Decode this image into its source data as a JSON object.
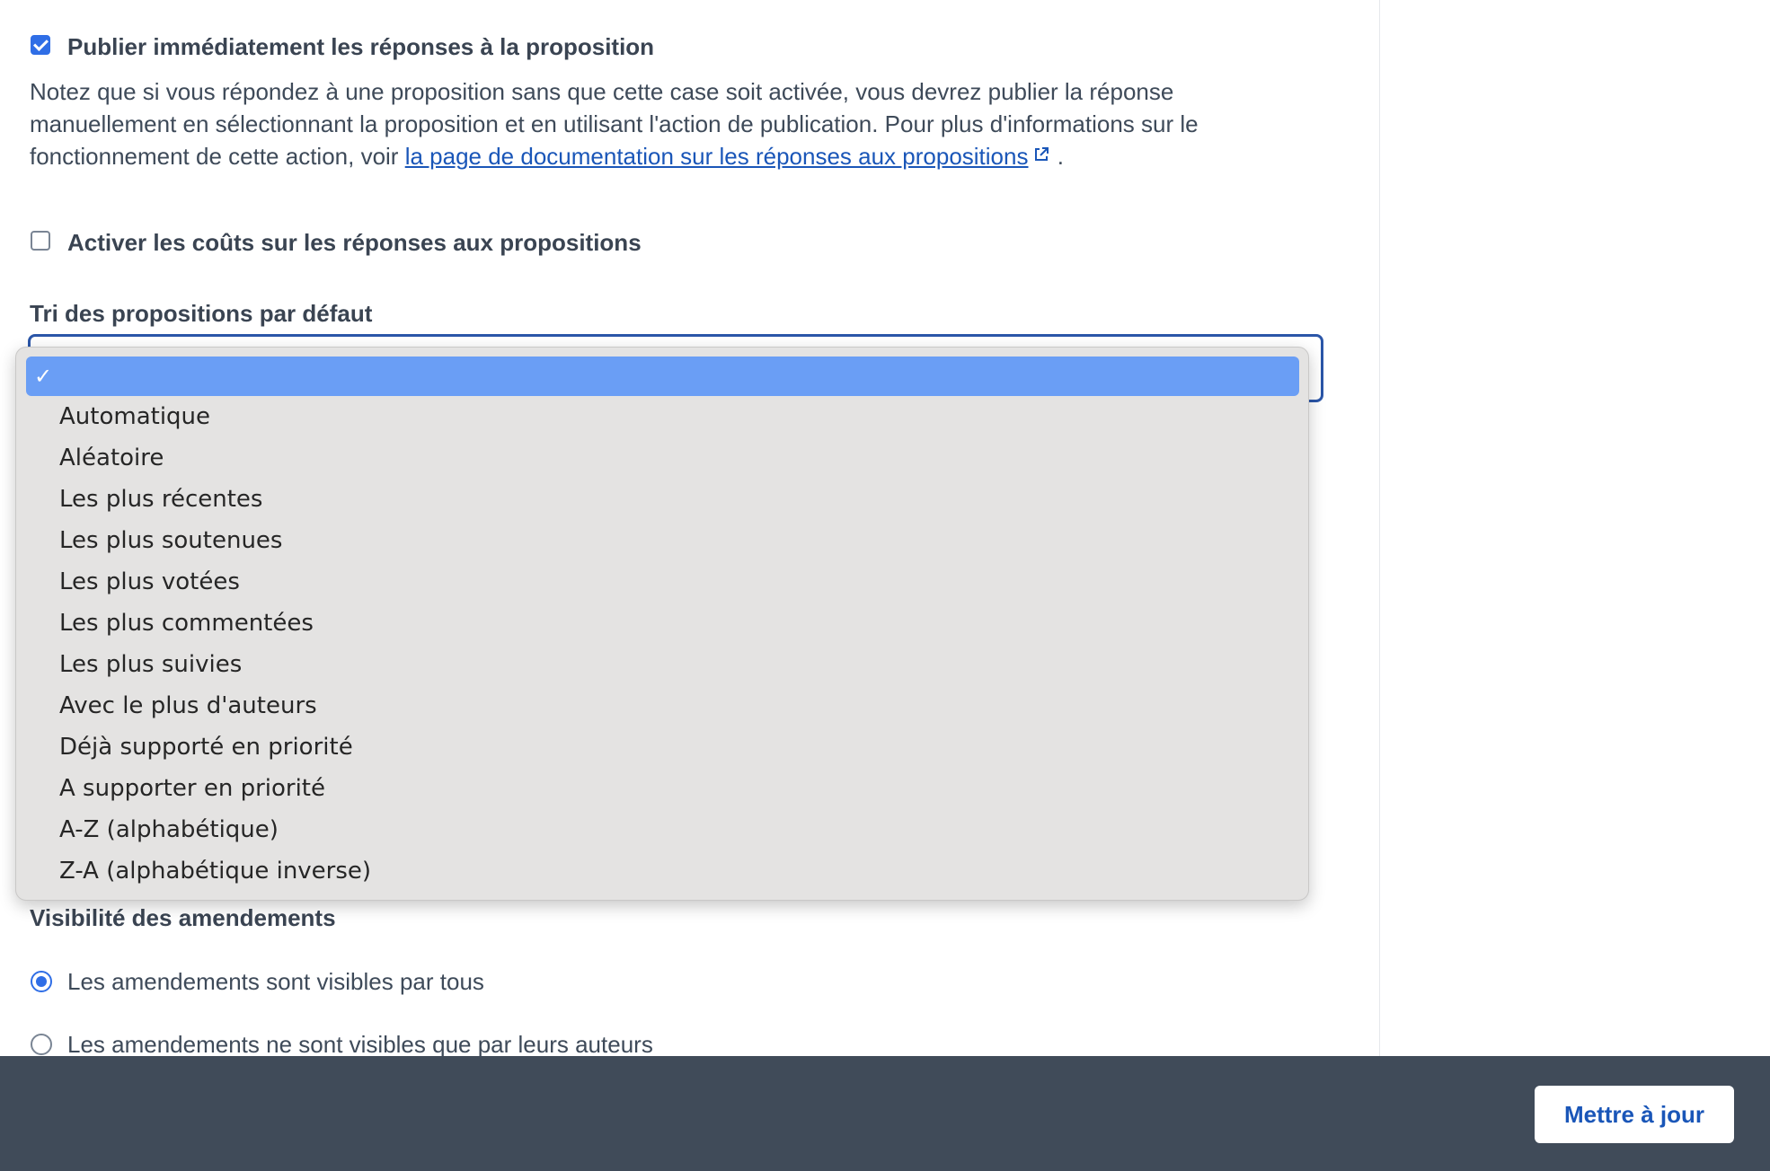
{
  "settings": {
    "publish_responses": {
      "label": "Publier immédiatement les réponses à la proposition",
      "checked": true,
      "help_prefix": "Notez que si vous répondez à une proposition sans que cette case soit activée, vous devrez publier la réponse manuellement en sélectionnant la proposition et en utilisant l'action de publication. Pour plus d'informations sur le fonctionnement de cette action, voir ",
      "help_link": "la page de documentation sur les réponses aux propositions",
      "help_suffix": " ."
    },
    "enable_costs": {
      "label": "Activer les coûts sur les réponses aux propositions",
      "checked": false
    },
    "default_sort": {
      "label": "Tri des propositions par défaut",
      "selected_value": "",
      "options": [
        "",
        "Automatique",
        "Aléatoire",
        "Les plus récentes",
        "Les plus soutenues",
        "Les plus votées",
        "Les plus commentées",
        "Les plus suivies",
        "Avec le plus d'auteurs",
        "Déjà supporté en priorité",
        "A supporter en priorité",
        "A-Z (alphabétique)",
        "Z-A (alphabétique inverse)"
      ]
    },
    "amendments_visibility": {
      "label": "Visibilité des amendements",
      "options": [
        {
          "label": "Les amendements sont visibles par tous",
          "selected": true
        },
        {
          "label": "Les amendements ne sont visibles que par leurs auteurs",
          "selected": false
        }
      ]
    }
  },
  "footer": {
    "update_button": "Mettre à jour"
  },
  "colors": {
    "accent": "#2f6ee6",
    "link": "#1a56b8",
    "dropdown_selected": "#6a9ef5",
    "footer_bg": "#404b59"
  }
}
